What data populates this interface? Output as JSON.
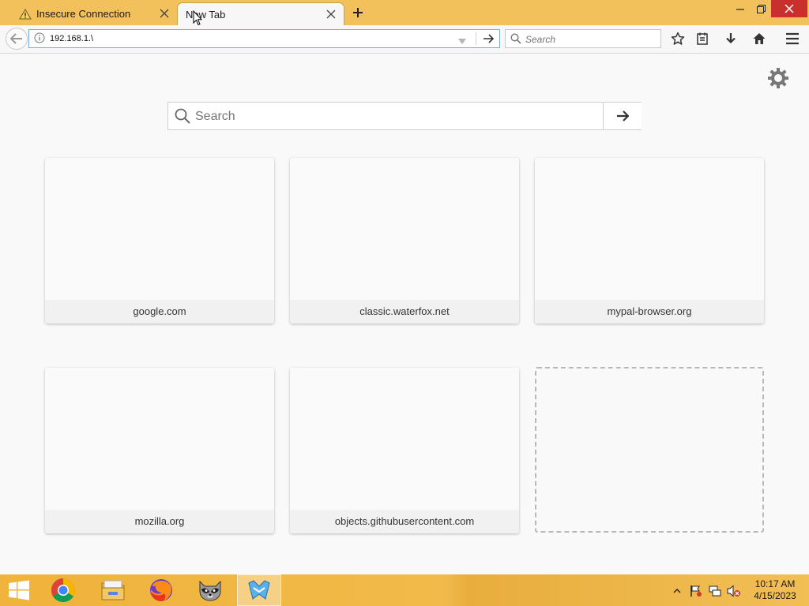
{
  "tabs": [
    {
      "label": "Insecure Connection",
      "icon": "warning-icon",
      "active": false
    },
    {
      "label": "New Tab",
      "active": true
    }
  ],
  "navbar": {
    "url_value": "192.168.1.\\",
    "search_placeholder": "Search"
  },
  "newtab": {
    "search_placeholder": "Search",
    "tiles": [
      {
        "title": "google.com"
      },
      {
        "title": "classic.waterfox.net"
      },
      {
        "title": "mypal-browser.org"
      },
      {
        "title": "mozilla.org"
      },
      {
        "title": "objects.githubusercontent.com"
      }
    ]
  },
  "taskbar": {
    "apps": [
      "windows-start-icon",
      "chrome-icon",
      "file-explorer-icon",
      "firefox-icon",
      "raccoon-icon",
      "waterfox-icon"
    ],
    "clock_time": "10:17 AM",
    "clock_date": "4/15/2023"
  },
  "colors": {
    "titlebar": "#f2c15b",
    "close_red": "#c7302d",
    "taskbar": "#f0b33b"
  }
}
